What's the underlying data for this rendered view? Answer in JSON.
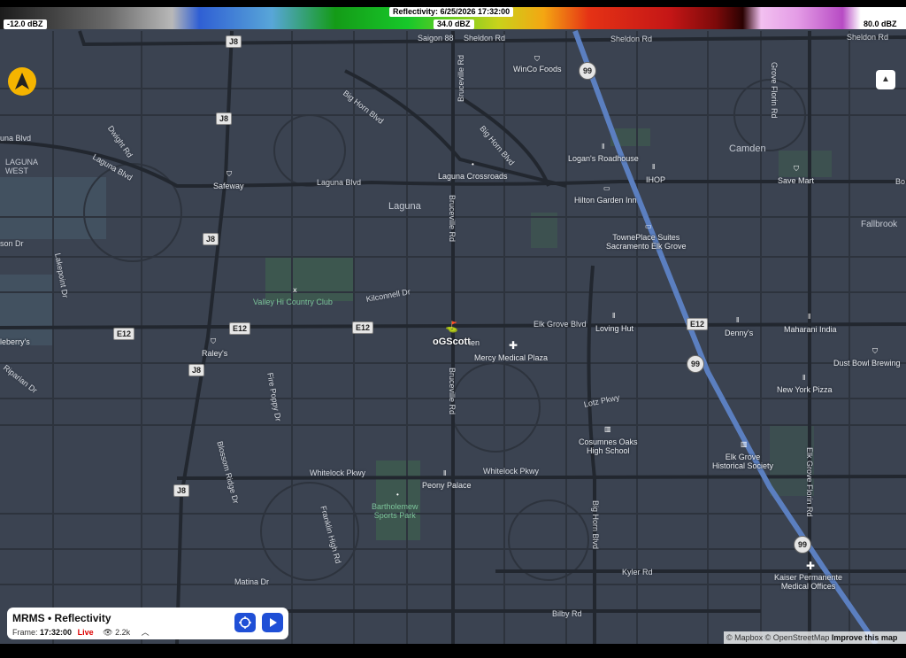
{
  "colorbar": {
    "min_label": "-12.0 dBZ",
    "title": "Reflectivity: 6/25/2026 17:32:00",
    "mid_label": "34.0 dBZ",
    "max_label": "80.0 dBZ"
  },
  "map_labels": {
    "saigon": "Saigon 88",
    "sheldon_rd_1": "Sheldon Rd",
    "sheldon_rd_2": "Sheldon Rd",
    "sheldon_rd_3": "Sheldon Rd",
    "winco": "WinCo Foods",
    "grove_florin_top": "Grove Florin Rd",
    "big_horn_1": "Big Horn Blvd",
    "big_horn_2": "Big Horn Blvd",
    "big_horn_3": "Big Horn Blvd",
    "bruceville_1": "Bruceville Rd",
    "bruceville_2": "Bruceville Rd",
    "bruceville_3": "Bruceville Rd",
    "laguna_blvd_left": "una Blvd",
    "laguna_blvd_1": "Laguna Blvd",
    "laguna_blvd_2": "Laguna Blvd",
    "dwight_rd": "Dwight Rd",
    "laguna_west": "LAGUNA\nWEST",
    "camden": "Camden",
    "logans": "Logan's Roadhouse",
    "laguna_crossroads": "Laguna Crossroads",
    "safeway": "Safeway",
    "ihop": "IHOP",
    "save_mart": "Save Mart",
    "bo": "Bo",
    "hilton": "Hilton Garden Inn",
    "laguna": "Laguna",
    "fallbrook": "Fallbrook",
    "son_dr": "son Dr",
    "towneplace": "TownePlace Suites\nSacramento Elk Grove",
    "lakepoint": "Lakepoint Dr",
    "kilconnell": "Kilconnell Dr",
    "valley_hi": "Valley Hi Country Club",
    "elk_grove_blvd": "Elk Grove Blvd",
    "loving_hut": "Loving Hut",
    "dennys": "Denny's",
    "maharani": "Maharani India",
    "leberrys": "leberry's",
    "raleys": "Raley's",
    "mercy": "Mercy Medical Plaza",
    "dust_bowl": "Dust Bowl Brewing",
    "riparian": "Riparian Dr",
    "fire_poppy": "Fire Poppy Dr",
    "new_york_pizza": "New York Pizza",
    "lotz": "Lotz Pkwy",
    "cosumnes": "Cosumnes Oaks\nHigh School",
    "elk_grove_hist": "Elk Grove\nHistorical Society",
    "blossom_ridge": "Blossom Ridge Dr",
    "whitelock_1": "Whitelock Pkwy",
    "whitelock_2": "Whitelock Pkwy",
    "peony": "Peony Palace",
    "elk_grove_florin": "Elk Grove Florin Rd",
    "bartholomew": "Bartholemew\nSports Park",
    "franklin": "Franklin High Rd",
    "big_horn_blvd_s": "Big Horn Blvd",
    "kyler": "Kyler Rd",
    "kaiser": "Kaiser Permanente\nMedical Offices",
    "matina": "Matina Dr",
    "bilby": "Bilby Rd"
  },
  "shields": {
    "j8": "J8",
    "e12": "E12",
    "hwy99": "99"
  },
  "marker": {
    "label": "oGScott",
    "suffix": "ien"
  },
  "panel": {
    "title": "MRMS • Reflectivity",
    "frame_label": "Frame:",
    "frame_time": "17:32:00",
    "live": "Live",
    "views": "2.2k"
  },
  "attribution": {
    "mapbox": "© Mapbox",
    "osm": "© OpenStreetMap",
    "improve": "Improve this map"
  },
  "colors": {
    "map_bg": "#3b4351",
    "road": "#22272f",
    "highway": "#5b7fc0",
    "park": "#3f5f4f",
    "compass": "#f5b400",
    "accent_button": "#1f4fd6",
    "live": "#dd0000"
  }
}
